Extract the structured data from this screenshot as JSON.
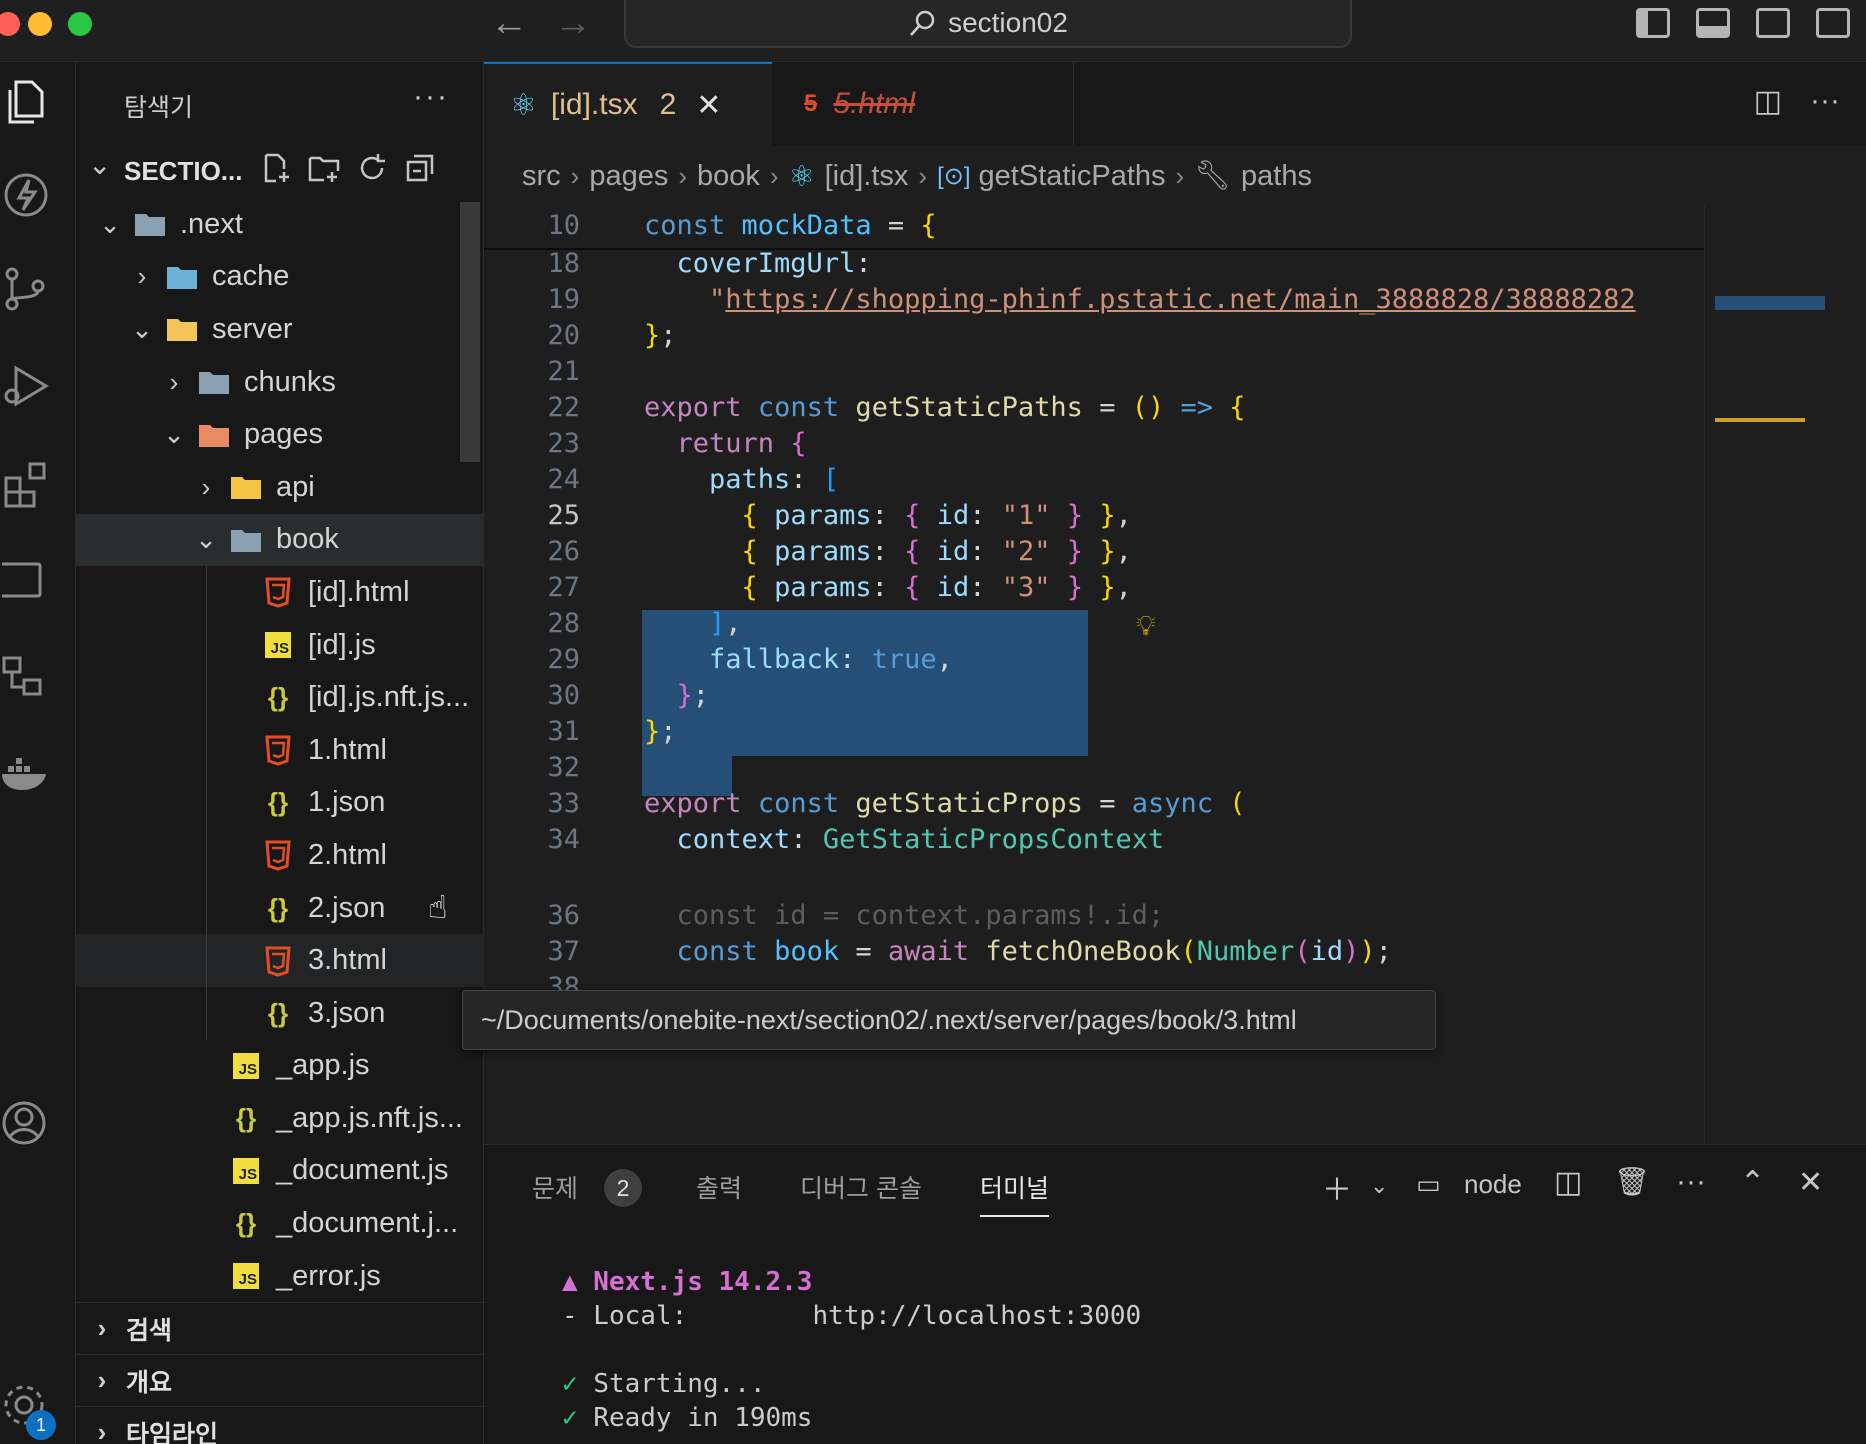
{
  "titlebar": {
    "search_text": "section02",
    "traffic_colors": [
      "#ff5f57",
      "#febc2e",
      "#28c840"
    ]
  },
  "sidebar": {
    "title": "탐색기",
    "more": "···",
    "section_title": "SECTIO...",
    "tree": [
      {
        "label": ".next",
        "depth": 0,
        "expanded": true,
        "icon": "folder-next-icon"
      },
      {
        "label": "cache",
        "depth": 1,
        "expanded": false,
        "icon": "folder-cache-icon"
      },
      {
        "label": "server",
        "depth": 1,
        "expanded": true,
        "icon": "folder-server-icon"
      },
      {
        "label": "chunks",
        "depth": 2,
        "expanded": false,
        "icon": "folder-icon"
      },
      {
        "label": "pages",
        "depth": 2,
        "expanded": true,
        "icon": "folder-pages-icon"
      },
      {
        "label": "api",
        "depth": 3,
        "expanded": false,
        "icon": "folder-api-icon"
      },
      {
        "label": "book",
        "depth": 3,
        "expanded": true,
        "icon": "folder-open-icon"
      },
      {
        "label": "[id].html",
        "depth": 4,
        "icon": "html-file-icon"
      },
      {
        "label": "[id].js",
        "depth": 4,
        "icon": "js-file-icon"
      },
      {
        "label": "[id].js.nft.js...",
        "depth": 4,
        "icon": "json-file-icon"
      },
      {
        "label": "1.html",
        "depth": 4,
        "icon": "html-file-icon"
      },
      {
        "label": "1.json",
        "depth": 4,
        "icon": "json-file-icon"
      },
      {
        "label": "2.html",
        "depth": 4,
        "icon": "html-file-icon"
      },
      {
        "label": "2.json",
        "depth": 4,
        "icon": "json-file-icon"
      },
      {
        "label": "3.html",
        "depth": 4,
        "icon": "html-file-icon"
      },
      {
        "label": "3.json",
        "depth": 4,
        "icon": "json-file-icon"
      },
      {
        "label": "_app.js",
        "depth": 3,
        "icon": "js-file-icon"
      },
      {
        "label": "_app.js.nft.js...",
        "depth": 3,
        "icon": "json-file-icon"
      },
      {
        "label": "_document.js",
        "depth": 3,
        "icon": "js-file-icon"
      },
      {
        "label": "_document.j...",
        "depth": 3,
        "icon": "json-file-icon"
      },
      {
        "label": "_error.js",
        "depth": 3,
        "icon": "js-file-icon"
      }
    ],
    "collapsed_sections": [
      "검색",
      "개요",
      "타임라인"
    ]
  },
  "tabs": [
    {
      "label": "[id].tsx",
      "badge": "2",
      "icon": "react-icon",
      "active": true
    },
    {
      "label": "5.html",
      "icon": "html-file-icon",
      "active": false,
      "deleted": true
    }
  ],
  "breadcrumbs": [
    "src",
    "pages",
    "book",
    "[id].tsx",
    "getStaticPaths",
    "paths"
  ],
  "code": {
    "line_numbers": [
      "10",
      "18",
      "19",
      "20",
      "21",
      "22",
      "23",
      "24",
      "25",
      "26",
      "27",
      "28",
      "29",
      "30",
      "31",
      "32",
      "33",
      "34",
      "36",
      "37",
      "38"
    ],
    "current_line": "25",
    "tokens": {
      "const": "const",
      "mockData": "mockData",
      "eq": " = ",
      "lbrace": "{",
      "rbrace": "}",
      "semi": ";",
      "coverImgUrl": "coverImgUrl",
      "colon": ":",
      "url_quote": "\"",
      "url": "https://shopping-phinf.pstatic.net/main_3888828/38888282",
      "export": "export",
      "getStaticPaths": "getStaticPaths",
      "arrow_parens": "()",
      "arrow": " => ",
      "return": "return",
      "paths": "paths",
      "lbracket": "[",
      "rbracket": "]",
      "params": "params",
      "id": "id",
      "id1": "\"1\"",
      "id2": "\"2\"",
      "id3": "\"3\"",
      "fallback": "fallback",
      "true": "true",
      "comma": ",",
      "getStaticProps": "getStaticProps",
      "async": "async",
      "lparen": "(",
      "rparen": ")",
      "context": "context",
      "GetStaticPropsContext": "GetStaticPropsContext",
      "ghost36": "const id = context.params!.id;",
      "book": "book",
      "await": "await",
      "fetchOneBook": "fetchOneBook",
      "Number": "Number"
    }
  },
  "tooltip": "~/Documents/onebite-next/section02/.next/server/pages/book/3.html",
  "panel": {
    "tabs": [
      "문제",
      "출력",
      "디버그 콘솔",
      "터미널"
    ],
    "problems_count": "2",
    "terminal_name": "node",
    "terminal_lines": {
      "l1": "▲ Next.js 14.2.3",
      "l2_label": "- Local:",
      "l2_value": "http://localhost:3000",
      "l3_mark": "✓",
      "l3": "Starting...",
      "l4_mark": "✓",
      "l4": "Ready in 190ms"
    }
  },
  "activity": {
    "settings_badge": "1"
  }
}
